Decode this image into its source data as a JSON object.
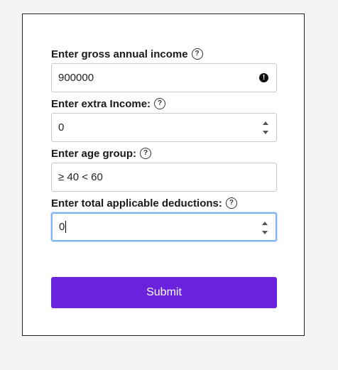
{
  "form": {
    "gross_income": {
      "label": "Enter gross annual income",
      "value": "900000",
      "help_icon": "question-circle-icon",
      "warning_icon": "exclamation-icon"
    },
    "extra_income": {
      "label": "Enter extra Income:",
      "value": "0",
      "help_icon": "question-circle-icon"
    },
    "age_group": {
      "label": "Enter age group:",
      "value": "≥ 40 < 60",
      "help_icon": "question-circle-icon"
    },
    "deductions": {
      "label": "Enter total applicable deductions:",
      "value": "0",
      "help_icon": "question-circle-icon"
    },
    "submit_label": "Submit"
  },
  "colors": {
    "submit_bg": "#6a22dd",
    "focus_border": "#7fb2f0"
  },
  "icons": {
    "help": "?",
    "warning": "!"
  }
}
